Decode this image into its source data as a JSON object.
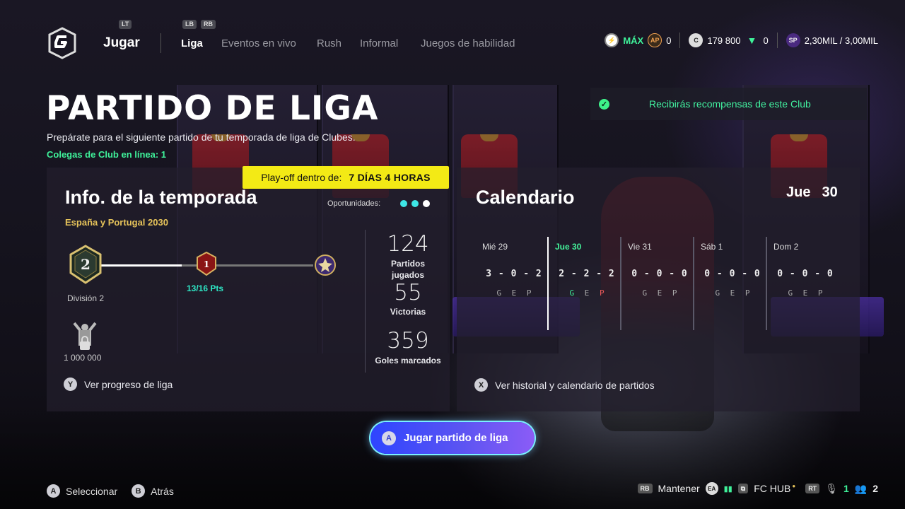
{
  "nav": {
    "jugar_label": "Jugar",
    "lt_tag": "LT",
    "lb_tag": "LB",
    "rb_tag": "RB",
    "tabs": [
      {
        "label": "Liga",
        "active": true
      },
      {
        "label": "Eventos en vivo",
        "active": false
      },
      {
        "label": "Rush",
        "active": false
      },
      {
        "label": "Informal",
        "active": false
      },
      {
        "label": "Juegos de habilidad",
        "active": false
      }
    ]
  },
  "currencies": {
    "max_label": "MÁX",
    "ap_value": "0",
    "coins_value": "179 800",
    "points_value": "0",
    "sp_value": "2,30MIL / 3,00MIL",
    "ap_icon_text": "AP",
    "sp_icon_text": "SP"
  },
  "header": {
    "title": "PARTIDO DE LIGA",
    "subtitle": "Prepárate para el siguiente partido de tu temporada de liga de Clubes.",
    "online": "Colegas de Club en línea: 1"
  },
  "reward_banner": {
    "text": "Recibirás recompensas de este Club"
  },
  "playoff": {
    "label": "Play-off dentro de:",
    "value": "7 DÍAS 4 HORAS"
  },
  "season": {
    "title": "Info. de la temporada",
    "name": "España y Portugal 2030",
    "opportunities_label": "Oportunidades:",
    "division_badge": "2",
    "next_badge": "1",
    "division_label": "División 2",
    "points_label": "13/16 Pts",
    "progress_fraction": 0.8125,
    "locked_value": "1 000 000",
    "stats": [
      {
        "value": "124",
        "label": "Partidos jugados"
      },
      {
        "value": "55",
        "label": "Victorias"
      },
      {
        "value": "359",
        "label": "Goles marcados"
      }
    ],
    "hint_button": "Y",
    "hint_label": "Ver progreso de liga"
  },
  "calendar": {
    "title": "Calendario",
    "current_day": "Jue",
    "current_date": "30",
    "days": [
      {
        "day": "Mié 29",
        "score": "3 - 0 - 2",
        "gep": "G E P",
        "active": false
      },
      {
        "day": "Jue 30",
        "score": "2 - 2 - 2",
        "gep": "G E P",
        "active": true
      },
      {
        "day": "Vie 31",
        "score": "0 - 0 - 0",
        "gep": "G E P",
        "active": false
      },
      {
        "day": "Sáb 1",
        "score": "0 - 0 - 0",
        "gep": "G E P",
        "active": false
      },
      {
        "day": "Dom 2",
        "score": "0 - 0 - 0",
        "gep": "G E P",
        "active": false
      }
    ],
    "hint_button": "X",
    "hint_label": "Ver historial y calendario de partidos"
  },
  "play_button": {
    "button": "A",
    "label": "Jugar partido de liga"
  },
  "footer": {
    "select_button": "A",
    "select_label": "Seleccionar",
    "back_button": "B",
    "back_label": "Atrás",
    "rb_tag": "RB",
    "hold_label": "Mantener",
    "ea_icon_text": "EA",
    "fchub_label": "FC HUB",
    "rt_tag": "RT",
    "mic_count": "1",
    "party_count": "2"
  },
  "colors": {
    "accent_green": "#3ff29a",
    "playoff_yellow": "#f3ea15",
    "play_button_blue": "#2e45ff",
    "gold": "#e6c35a"
  }
}
